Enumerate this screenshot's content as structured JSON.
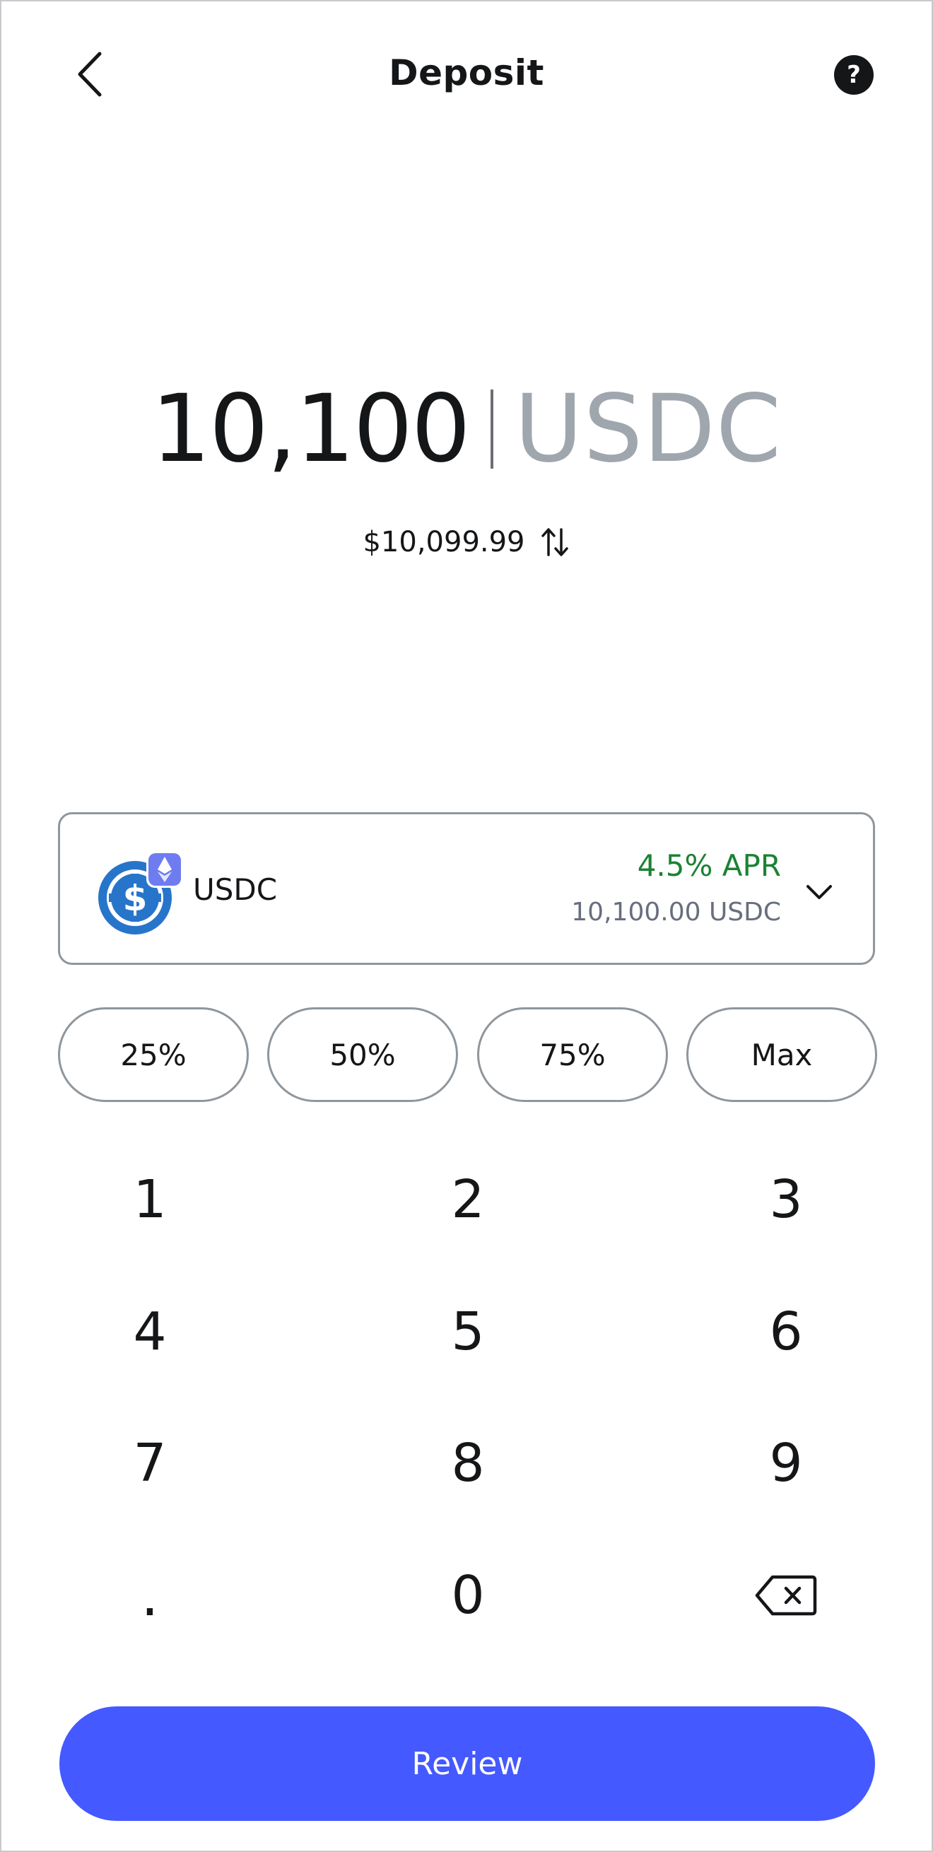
{
  "header": {
    "title": "Deposit",
    "help_label": "?"
  },
  "amount": {
    "value": "10,100",
    "unit": "USDC",
    "fiat": "$10,099.99"
  },
  "token": {
    "name": "USDC",
    "apr": "4.5% APR",
    "balance": "10,100.00 USDC"
  },
  "percent_buttons": [
    "25%",
    "50%",
    "75%",
    "Max"
  ],
  "keypad": [
    "1",
    "2",
    "3",
    "4",
    "5",
    "6",
    "7",
    "8",
    "9",
    ".",
    "0"
  ],
  "review_label": "Review",
  "colors": {
    "accent": "#4459ff",
    "apr_green": "#1c8234",
    "muted": "#9fa6ad",
    "usdc_blue": "#2775ca",
    "eth_badge": "#6f7cf0"
  },
  "icons": {
    "back": "chevron-left-icon",
    "help": "question-circle-icon",
    "swap": "swap-arrows-icon",
    "token": "usdc-logo",
    "network": "ethereum-badge",
    "dropdown": "chevron-down-icon",
    "delete": "backspace-icon"
  }
}
